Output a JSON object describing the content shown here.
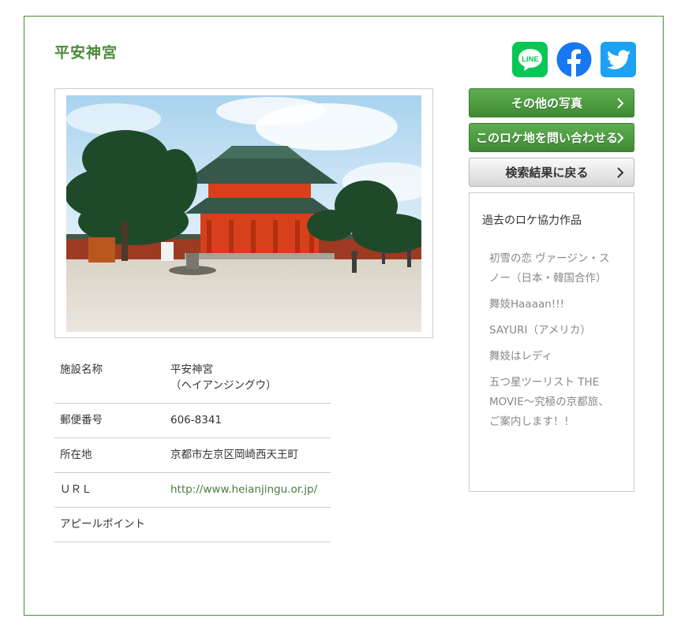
{
  "page": {
    "title": "平安神宮"
  },
  "social": {
    "line_label": "LINE",
    "colors": {
      "line": "#06c755",
      "facebook": "#1877f2",
      "twitter": "#1da1f2"
    }
  },
  "photo": {
    "subject": "平安神宮 応天門"
  },
  "info": {
    "rows": [
      {
        "key": "施設名称",
        "value": "平安神宮",
        "value2": "（ヘイアンジングウ）"
      },
      {
        "key": "郵便番号",
        "value": "606-8341"
      },
      {
        "key": "所在地",
        "value": "京都市左京区岡崎西天王町"
      },
      {
        "key": "ＵＲＬ",
        "value": "http://www.heianjingu.or.jp/"
      },
      {
        "key": "アピールポイント",
        "value": ""
      }
    ]
  },
  "buttons": {
    "other_photos": "その他の写真",
    "inquire": "このロケ地を問い合わせる",
    "back": "検索結果に戻る"
  },
  "works": {
    "heading": "過去のロケ協力作品",
    "items": [
      "初雪の恋 ヴァージン・スノー（日本・韓国合作）",
      "舞妓Haaaan!!!",
      "SAYURI（アメリカ）",
      "舞妓はレディ",
      "五つ星ツーリスト THE MOVIE～究極の京都旅、ご案内します！！"
    ]
  },
  "colors": {
    "accent": "#4a8a3a",
    "border": "#cccccc"
  }
}
